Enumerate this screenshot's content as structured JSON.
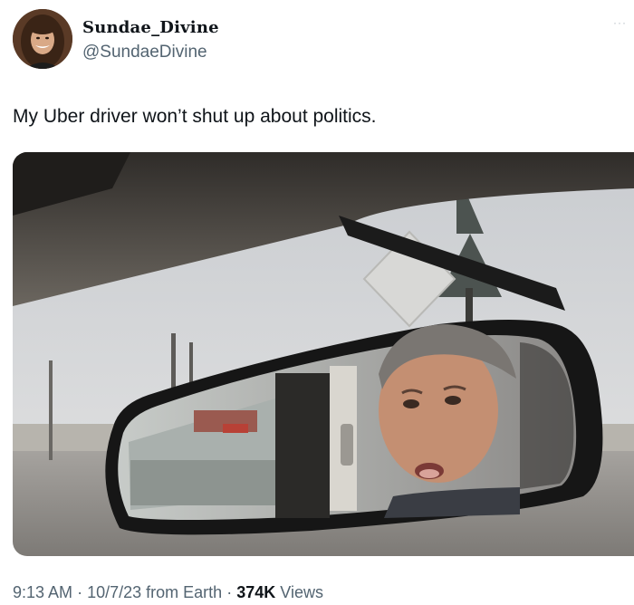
{
  "author": {
    "display_name": "Sundae_Divine",
    "handle": "@SundaeDivine",
    "avatar_icon": "profile-photo"
  },
  "more_icon": "ellipsis-icon",
  "tweet": {
    "text": "My Uber driver won’t shut up about politics."
  },
  "media": {
    "kind": "photo",
    "subject": "rear-view-mirror"
  },
  "meta": {
    "time": "9:13 AM",
    "separator": "·",
    "date": "10/7/23",
    "source": "from Earth",
    "views_count": "374K",
    "views_label": "Views"
  }
}
